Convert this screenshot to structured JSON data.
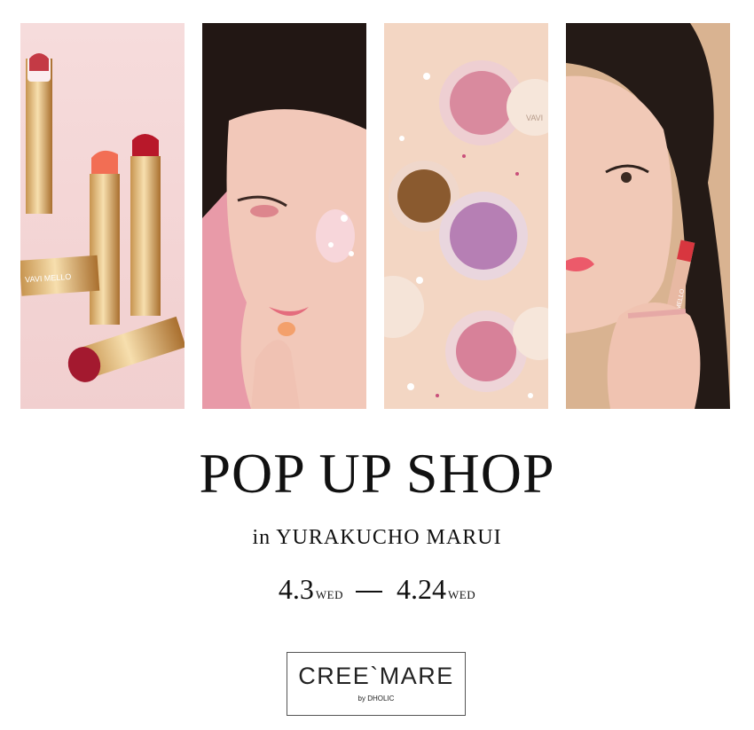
{
  "header": {
    "photo_labels": {
      "lipstick_brand": "VAVI MELLO",
      "jar_brand": "VAVI",
      "tube_brand": "VAVI MELLO"
    }
  },
  "event": {
    "title": "POP UP SHOP",
    "location": "in YURAKUCHO MARUI",
    "start_date": "4.3",
    "start_day": "WED",
    "end_date": "4.24",
    "end_day": "WED"
  },
  "brand": {
    "name": "CREE`MARE",
    "sub": "by DHOLIC"
  },
  "colors": {
    "background": "#ffffff",
    "text": "#111111"
  }
}
